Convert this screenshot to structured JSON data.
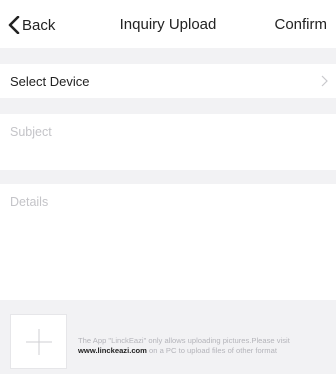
{
  "navbar": {
    "back_label": "Back",
    "title": "Inquiry Upload",
    "confirm_label": "Confirm"
  },
  "device": {
    "label": "Select Device"
  },
  "subject": {
    "placeholder": "Subject"
  },
  "details": {
    "placeholder": "Details"
  },
  "upload": {
    "notice_before": "The App \"LinckEazi\" only allows uploading pictures.Please visit",
    "notice_link": "www.linckeazi.com",
    "notice_after": " on a PC to upload files of other format"
  },
  "icons": {
    "back": "chevron-left-icon",
    "device_arrow": "chevron-right-icon",
    "add": "plus-icon"
  },
  "colors": {
    "background": "#ffffff",
    "separator": "#f2f2f4",
    "placeholder": "#c4c4c8",
    "text": "#222222"
  }
}
